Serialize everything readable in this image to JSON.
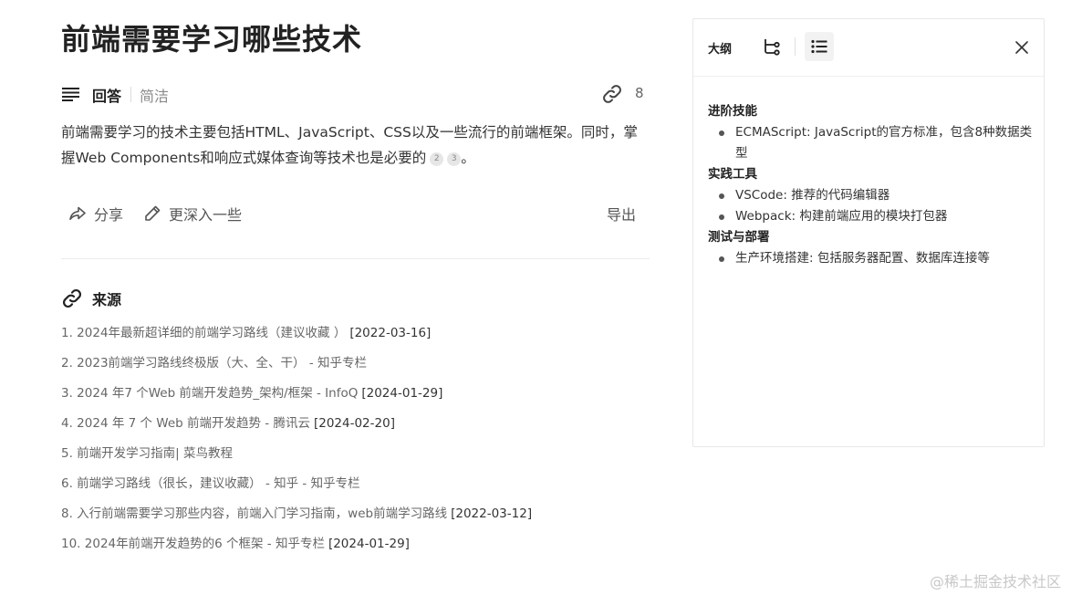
{
  "page": {
    "title": "前端需要学习哪些技术"
  },
  "answer": {
    "tab_answer": "回答",
    "tab_brief": "简洁",
    "link_count": "8",
    "text": "前端需要学习的技术主要包括HTML、JavaScript、CSS以及一些流行的前端框架。同时，掌握Web Components和响应式媒体查询等技术也是必要的",
    "citations": [
      "2",
      "3"
    ],
    "end_mark": "。"
  },
  "actions": {
    "share": "分享",
    "deeper": "更深入一些",
    "export": "导出"
  },
  "sources": {
    "title": "来源",
    "items": [
      {
        "text": "1. 2024年最新超详细的前端学习路线（建议收藏 ）",
        "date": "[2022-03-16]"
      },
      {
        "text": "2. 2023前端学习路线终极版（大、全、干） - 知乎专栏",
        "date": ""
      },
      {
        "text": "3. 2024 年7 个Web 前端开发趋势_架构/框架 - InfoQ",
        "date": "[2024-01-29]"
      },
      {
        "text": "4. 2024 年 7 个 Web 前端开发趋势 - 腾讯云",
        "date": "[2024-02-20]"
      },
      {
        "text": "5. 前端开发学习指南| 菜鸟教程",
        "date": ""
      },
      {
        "text": "6. 前端学习路线（很长，建议收藏） - 知乎 - 知乎专栏",
        "date": ""
      },
      {
        "text": "8. 入行前端需要学习那些内容，前端入门学习指南，web前端学习路线",
        "date": "[2022-03-12]"
      },
      {
        "text": "10. 2024年前端开发趋势的6 个框架 - 知乎专栏",
        "date": "[2024-01-29]"
      }
    ]
  },
  "panel": {
    "tab_outline": "大纲",
    "sections": [
      {
        "title": "进阶技能",
        "bullets": [
          "ECMAScript: JavaScript的官方标准，包含8种数据类型"
        ]
      },
      {
        "title": "实践工具",
        "bullets": [
          "VSCode: 推荐的代码编辑器",
          "Webpack: 构建前端应用的模块打包器"
        ]
      },
      {
        "title": "测试与部署",
        "bullets": [
          "生产环境搭建: 包括服务器配置、数据库连接等"
        ]
      }
    ]
  },
  "watermark": "@稀土掘金技术社区"
}
